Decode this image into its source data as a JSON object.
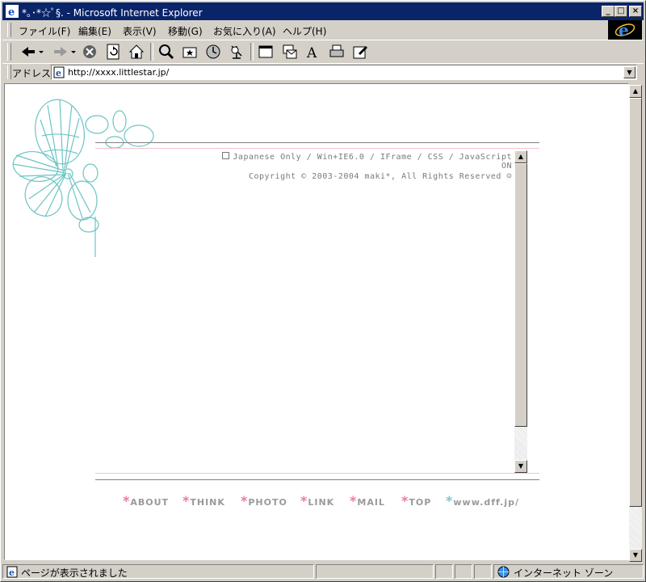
{
  "window": {
    "title": "*｡･*☆ﾟ§. - Microsoft Internet Explorer",
    "controls": [
      "_",
      "□",
      "×"
    ]
  },
  "menubar": {
    "items": [
      "ファイル(F)",
      "編集(E)",
      "表示(V)",
      "移動(G)",
      "お気に入り(A)",
      "ヘルプ(H)"
    ]
  },
  "toolbar": {
    "icons": [
      "back-icon",
      "forward-icon",
      "stop-icon",
      "refresh-icon",
      "home-icon",
      "search-icon",
      "favorites-icon",
      "history-icon",
      "channels-icon",
      "fullscreen-icon",
      "mail-icon",
      "font-icon",
      "print-icon",
      "edit-icon"
    ]
  },
  "address": {
    "label": "アドレス",
    "url": "http://xxxx.littlestar.jp/"
  },
  "page": {
    "info_line1": "Japanese Only / Win+IE6.0 / IFrame / CSS / JavaScript ON",
    "info_line2": "Copyright © 2003-2004 maki*, All Rights Reserved ☺",
    "nav": [
      {
        "star": "*",
        "label": "ABOUT"
      },
      {
        "star": "*",
        "label": "THINK"
      },
      {
        "star": "*",
        "label": "PHOTO"
      },
      {
        "star": "*",
        "label": "LINK"
      },
      {
        "star": "*",
        "label": "MAIL"
      },
      {
        "star": "*",
        "label": "TOP"
      },
      {
        "star": "*",
        "label": "www.dff.jp/"
      }
    ]
  },
  "statusbar": {
    "message": "ページが表示されました",
    "zone": "インターネット ゾーン"
  },
  "colors": {
    "titlebar": "#0a246a",
    "accent_pink": "#f07a9a",
    "accent_teal": "#7cc8c8",
    "flower_line": "#6cc4c4"
  }
}
